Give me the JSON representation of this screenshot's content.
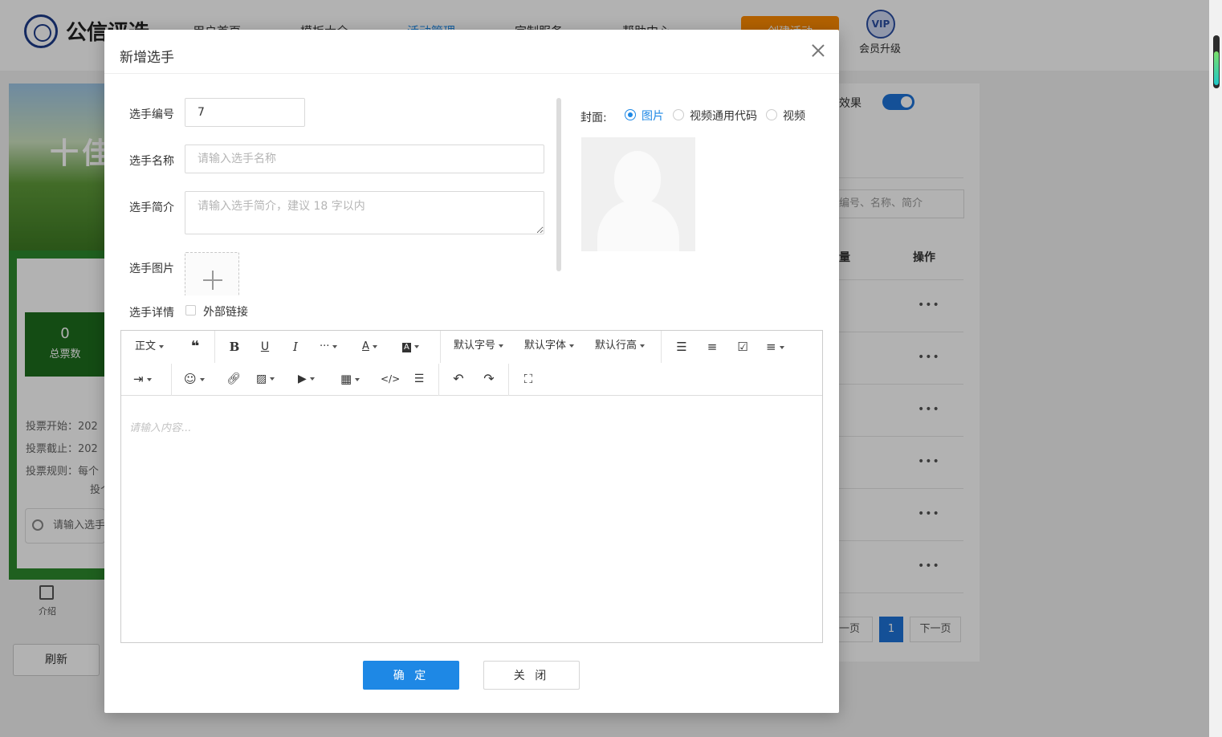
{
  "background": {
    "brand": "公信评选",
    "nav": [
      "用户首页",
      "模板大全",
      "活动管理",
      "定制服务",
      "帮助中心"
    ],
    "create_button": "创建活动",
    "vip_badge": "VIP",
    "vip_label": "会员升级",
    "banner_text": "十佳",
    "total_votes_value": "0",
    "total_votes_label": "总票数",
    "vote_start": "投票开始：202",
    "vote_end": "投票截止：202",
    "vote_rule": "投票规则：每个",
    "vote_rule_cont": "投个",
    "search_placeholder": "请输入选手",
    "intro_label": "介绍",
    "refresh_button": "刷新",
    "effect_label": "效果",
    "right_search_placeholder": "编号、名称、简介",
    "col_votes": "量",
    "col_action": "操作",
    "row_action": "•••",
    "pager_prev": "一页",
    "pager_current": "1",
    "pager_next": "下一页"
  },
  "modal": {
    "title": "新增选手",
    "fields": {
      "number_label": "选手编号",
      "number_value": "7",
      "name_label": "选手名称",
      "name_placeholder": "请输入选手名称",
      "intro_label": "选手简介",
      "intro_placeholder": "请输入选手简介，建议 18 字以内",
      "image_label": "选手图片",
      "detail_label": "选手详情",
      "external_link_label": "外部链接"
    },
    "cover": {
      "label": "封面:",
      "options": [
        "图片",
        "视频通用代码",
        "视频"
      ],
      "selected": "图片"
    },
    "editor": {
      "toolbar": {
        "paragraph": "正文",
        "font_size": "默认字号",
        "font_family": "默认字体",
        "line_height": "默认行高"
      },
      "placeholder": "请输入内容..."
    },
    "confirm_button": "确 定",
    "close_button": "关 闭"
  },
  "colors": {
    "primary": "#1e88e5",
    "overlay": "rgba(0,0,0,0.3)",
    "banner_green": "#2d8a2d",
    "create_orange": "#ff8c00"
  }
}
